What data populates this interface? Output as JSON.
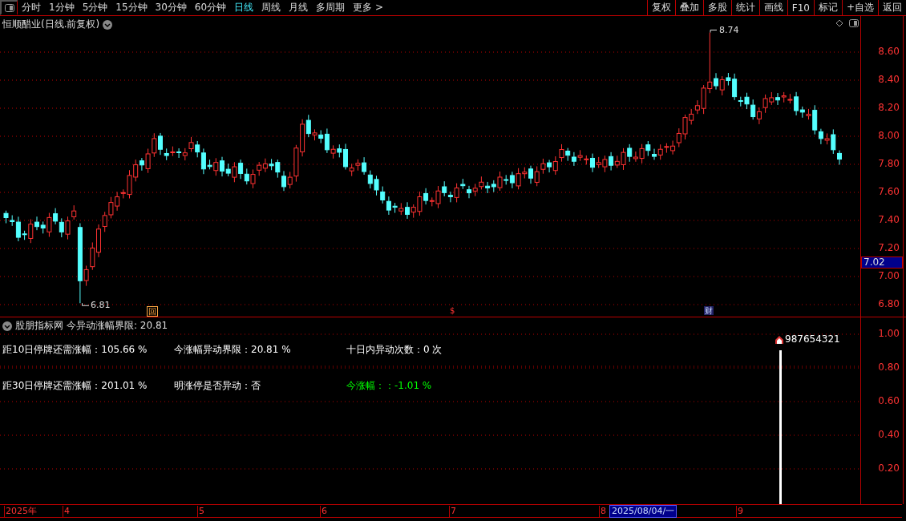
{
  "toolbar": {
    "tabs": [
      {
        "label": "分时",
        "selected": false
      },
      {
        "label": "1分钟",
        "selected": false
      },
      {
        "label": "5分钟",
        "selected": false
      },
      {
        "label": "15分钟",
        "selected": false
      },
      {
        "label": "30分钟",
        "selected": false
      },
      {
        "label": "60分钟",
        "selected": false
      },
      {
        "label": "日线",
        "selected": true
      },
      {
        "label": "周线",
        "selected": false
      },
      {
        "label": "月线",
        "selected": false
      },
      {
        "label": "多周期",
        "selected": false
      },
      {
        "label": "更多 >",
        "selected": false
      }
    ],
    "buttons": [
      "复权",
      "叠加",
      "多股",
      "统计",
      "画线",
      "F10",
      "标记",
      "+自选",
      "返回"
    ]
  },
  "price_pane": {
    "title": "恒顺醋业(日线.前复权)",
    "high_label": "8.74",
    "low_label": "6.81",
    "axis_ticks": [
      "8.60",
      "8.40",
      "8.20",
      "8.00",
      "7.80",
      "7.60",
      "7.40",
      "7.20",
      "7.00",
      "6.80"
    ],
    "current_price": "7.02",
    "markers": [
      {
        "kind": "boxed",
        "text": "回"
      },
      {
        "kind": "plain",
        "text": "$"
      },
      {
        "kind": "info",
        "text": "财"
      }
    ]
  },
  "indicator_pane": {
    "title": "股朋指标网",
    "subtitle": "今异动涨幅界限: 20.81",
    "rows": [
      [
        {
          "text": "距10日停牌还需涨幅：105.66 %",
          "kind": "normal"
        },
        {
          "text": "今涨幅异动界限：20.81 %",
          "kind": "normal"
        },
        {
          "text": "十日内异动次数：0 次",
          "kind": "normal"
        }
      ],
      [
        {
          "text": "距30日停牌还需涨幅：201.01 %",
          "kind": "normal"
        },
        {
          "text": "明涨停是否异动：否",
          "kind": "normal"
        },
        {
          "text": "今涨幅：：-1.01 %",
          "kind": "change"
        }
      ]
    ],
    "signal_label": "987654321",
    "axis_ticks": [
      "1.00",
      "0.80",
      "0.60",
      "0.40",
      "0.20"
    ]
  },
  "time_axis": {
    "labels": [
      "2025年",
      "4",
      "5",
      "6",
      "7",
      "8",
      "9"
    ],
    "cursor_date": "2025/08/04/一"
  }
}
